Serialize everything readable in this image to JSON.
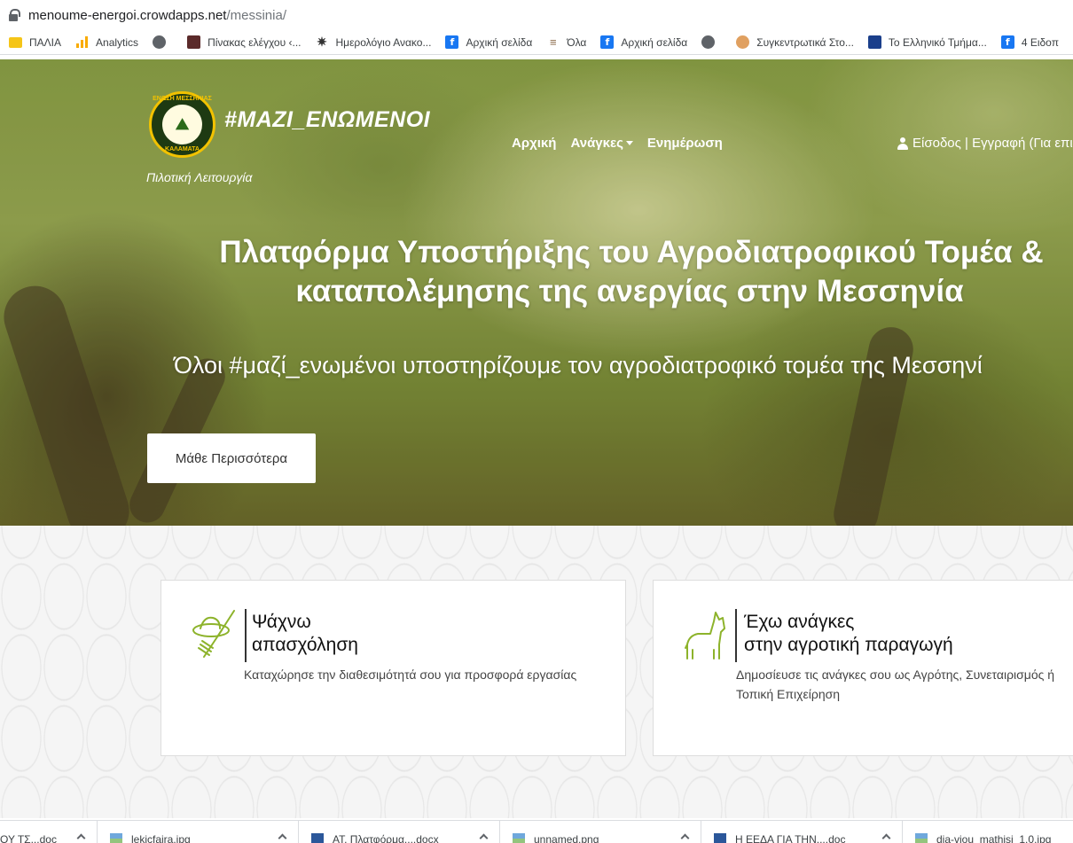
{
  "browser": {
    "url_host": "menoume-energoi.crowdapps.net",
    "url_path": "/messinia/",
    "bookmarks": [
      {
        "label": "ΠΑΛΙΑ",
        "icon": "folder-icon"
      },
      {
        "label": "Analytics",
        "icon": "analytics-icon"
      },
      {
        "label": "",
        "icon": "globe-icon"
      },
      {
        "label": "Πίνακας ελέγχου ‹...",
        "icon": "dashboard-icon"
      },
      {
        "label": "Ημερολόγιο Ανακο...",
        "icon": "calendar-icon"
      },
      {
        "label": "Αρχική σελίδα",
        "icon": "facebook-icon"
      },
      {
        "label": "Όλα",
        "icon": "list-icon"
      },
      {
        "label": "Αρχική σελίδα",
        "icon": "facebook-icon"
      },
      {
        "label": "",
        "icon": "globe-icon"
      },
      {
        "label": "Συγκεντρωτικά Στο...",
        "icon": "site-icon"
      },
      {
        "label": "Το Ελληνικό Τμήμα...",
        "icon": "eu-icon"
      },
      {
        "label": "4 Ειδοπ",
        "icon": "facebook-icon"
      }
    ]
  },
  "site": {
    "hashtag": "#ΜΑΖΙ_ΕΝΩΜΕΝΟΙ",
    "logo_top": "ΕΝΩΣΗ ΜΕΣΣΗΝΙΑΣ",
    "logo_bottom": "ΚΑΛΑΜΑΤΑ",
    "pilot": "Πιλοτική Λειτουργία",
    "nav": {
      "home": "Αρχική",
      "needs": "Ανάγκες",
      "news": "Ενημέρωση"
    },
    "login": "Είσοδος | Εγγραφή (Για επι",
    "hero_title_1": "Πλατφόρμα Υποστήριξης του Αγροδιατροφικού Τομέα &",
    "hero_title_2": "καταπολέμησης της ανεργίας στην Μεσσηνία",
    "hero_subtitle": "Όλοι #μαζί_ενωμένοι υποστηρίζουμε τον αγροδιατροφικό τομέα της Μεσσηνί",
    "learn_more": "Μάθε Περισσότερα"
  },
  "cards": [
    {
      "title_1": "Ψάχνω",
      "title_2": "απασχόληση",
      "description": "Καταχώρησε την διαθεσιμότητά σου για προσφορά εργασίας",
      "icon": "farmer-hat-rake-icon"
    },
    {
      "title_1": "Έχω ανάγκες",
      "title_2": "στην αγροτική παραγωγή",
      "description": "Δημοσίευσε τις ανάγκες σου ως Αγρότης, Συνεταιρισμός ή Τοπική Επιχείρηση",
      "icon": "goat-icon"
    }
  ],
  "downloads": [
    {
      "name": "ΟΥ ΤΣ...doc"
    },
    {
      "name": "lekicfaira.jpg"
    },
    {
      "name": "ΑΤ. Πλατφόρμα....docx"
    },
    {
      "name": "unnamed.png"
    },
    {
      "name": "Η ΕΕΔΑ ΓΙΑ ΤΗΝ....doc"
    },
    {
      "name": "dia-viou_mathisi_1.0.jpg"
    }
  ],
  "accent_colors": {
    "icon_green": "#8db32b",
    "logo_gold": "#f2c200",
    "logo_green": "#1e3a12"
  }
}
